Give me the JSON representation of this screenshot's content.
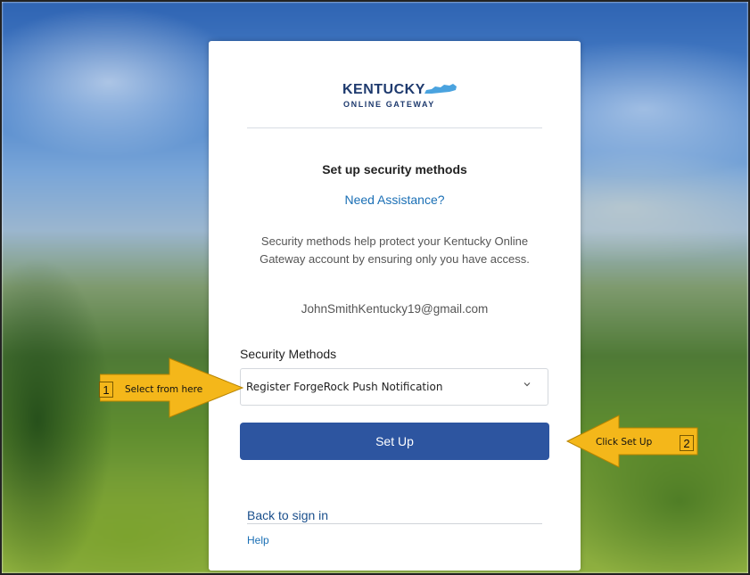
{
  "brand": {
    "name_line1": "KENTUCKY",
    "name_line2": "ONLINE GATEWAY"
  },
  "page": {
    "title": "Set up security methods",
    "assistance_link": "Need Assistance?",
    "description": "Security methods help protect your Kentucky Online Gateway account by ensuring only you have access.",
    "email": "JohnSmithKentucky19@gmail.com"
  },
  "form": {
    "security_methods_label": "Security Methods",
    "selected_method": "Register ForgeRock Push Notification",
    "setup_button": "Set Up"
  },
  "footer": {
    "back_link": "Back to sign in",
    "help_link": "Help"
  },
  "callouts": [
    {
      "number": "1",
      "label": "Select from here"
    },
    {
      "number": "2",
      "label": "Click Set Up"
    }
  ],
  "colors": {
    "primary_button": "#2d55a0",
    "link": "#1a6fb5",
    "callout": "#f4b71a"
  }
}
